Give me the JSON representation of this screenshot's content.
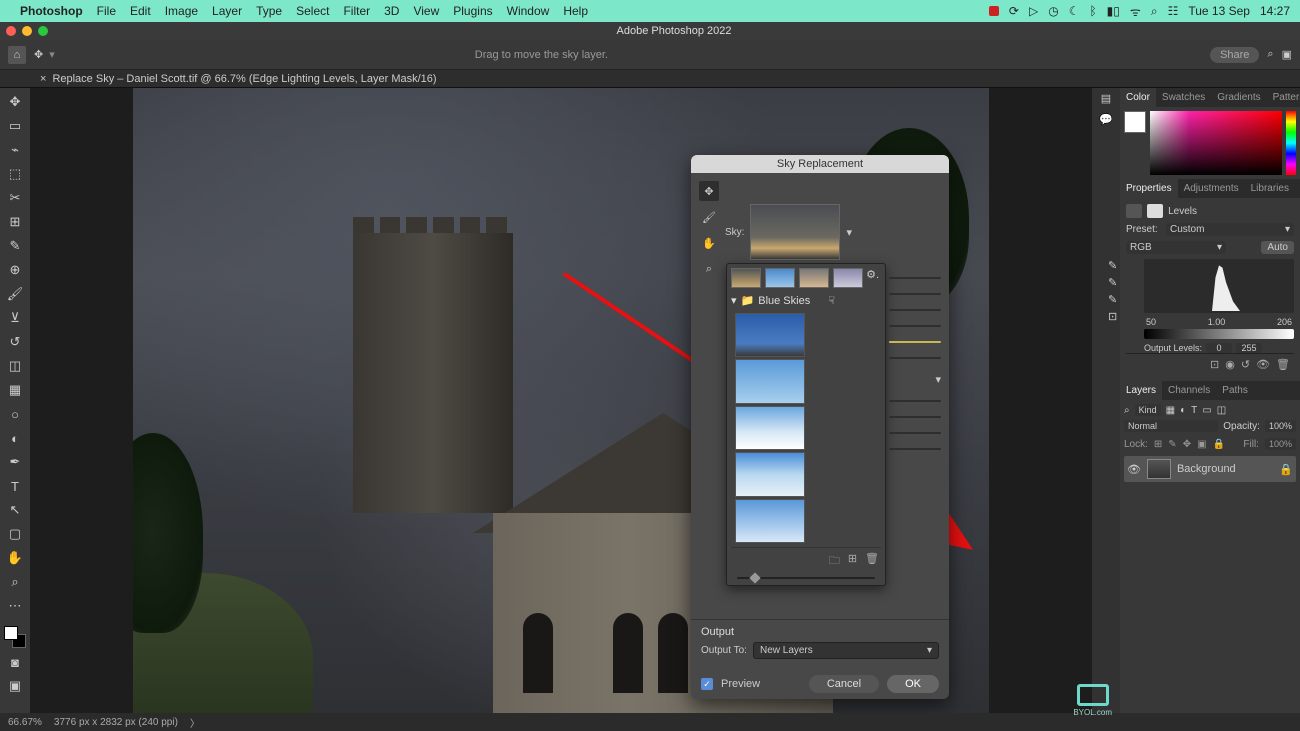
{
  "menubar": {
    "app": "Photoshop",
    "items": [
      "File",
      "Edit",
      "Image",
      "Layer",
      "Type",
      "Select",
      "Filter",
      "3D",
      "View",
      "Plugins",
      "Window",
      "Help"
    ],
    "date": "Tue 13 Sep",
    "time": "14:27"
  },
  "titlebar": {
    "title": "Adobe Photoshop 2022"
  },
  "optionbar": {
    "hint": "Drag to move the sky layer.",
    "share": "Share"
  },
  "doctab": {
    "label": "Replace Sky – Daniel Scott.tif @ 66.7% (Edge Lighting Levels, Layer Mask/16)"
  },
  "dialog": {
    "title": "Sky Replacement",
    "sky_label": "Sky:",
    "folder": "Blue Skies",
    "output_heading": "Output",
    "output_to_label": "Output To:",
    "output_to_value": "New Layers",
    "preview": "Preview",
    "cancel": "Cancel",
    "ok": "OK"
  },
  "panels": {
    "color_tabs": [
      "Color",
      "Swatches",
      "Gradients",
      "Patterns"
    ],
    "props_tabs": [
      "Properties",
      "Adjustments",
      "Libraries"
    ],
    "levels_label": "Levels",
    "preset_label": "Preset:",
    "preset_value": "Custom",
    "channel_value": "RGB",
    "auto": "Auto",
    "triple": {
      "a": "50",
      "b": "1.00",
      "c": "206"
    },
    "output_levels_label": "Output Levels:",
    "outlev_a": "0",
    "outlev_b": "255",
    "layers_tabs": [
      "Layers",
      "Channels",
      "Paths"
    ],
    "kind": "Kind",
    "blend": "Normal",
    "opacity_label": "Opacity:",
    "opacity_value": "100%",
    "lock_label": "Lock:",
    "fill_label": "Fill:",
    "fill_value": "100%",
    "layer_name": "Background"
  },
  "status": {
    "zoom": "66.67%",
    "dims": "3776 px x 2832 px (240 ppi)"
  },
  "byol": "BYOL.com"
}
